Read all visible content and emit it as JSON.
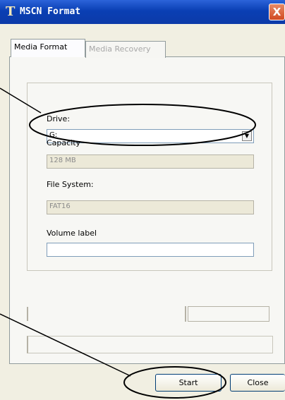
{
  "window": {
    "title": "MSCN Format",
    "close_glyph": "X"
  },
  "tabs": [
    {
      "label": "Media Format",
      "active": true
    },
    {
      "label": "Media Recovery",
      "active": false
    }
  ],
  "form": {
    "drive_label": "Drive:",
    "drive_value": "G:",
    "capacity_label": "Capacity",
    "capacity_value": "128 MB",
    "filesystem_label": "File System:",
    "filesystem_value": "FAT16",
    "volume_label_label": "Volume label",
    "volume_label_value": ""
  },
  "buttons": {
    "start": "Start",
    "close": "Close"
  }
}
